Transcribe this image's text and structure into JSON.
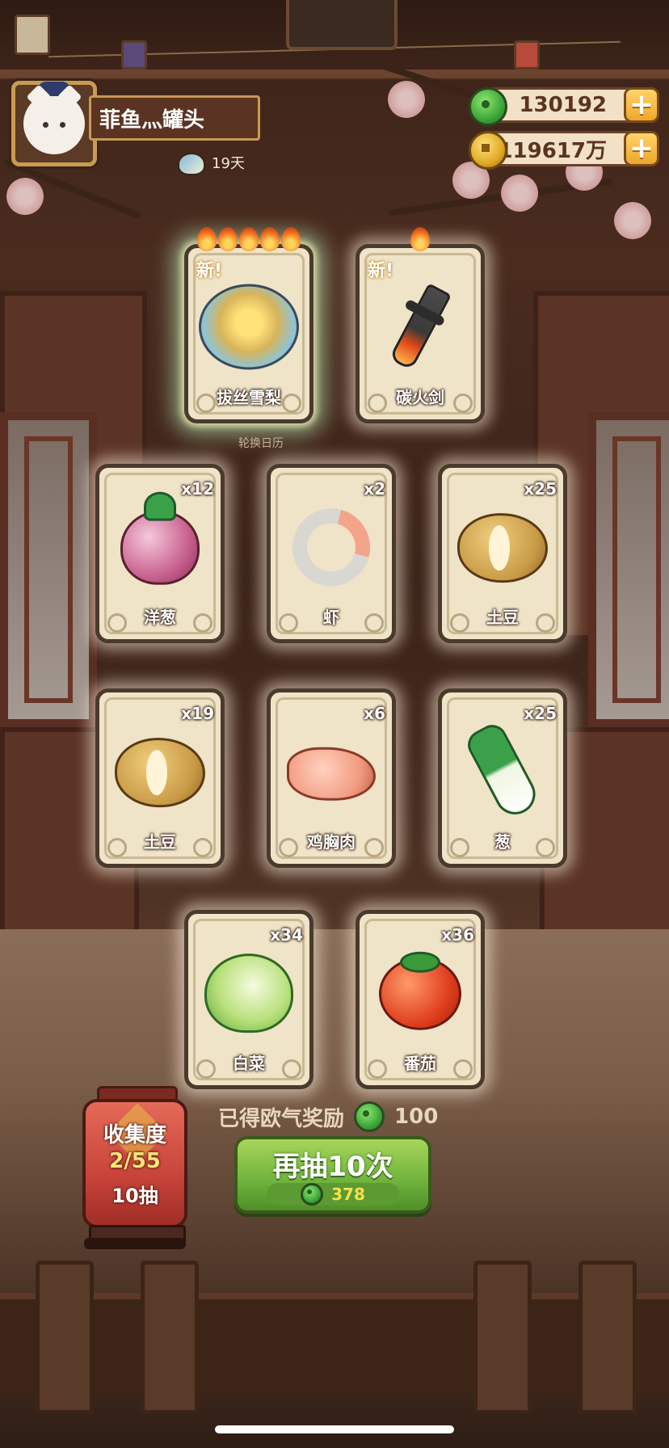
{
  "player": {
    "name": "菲鱼灬罐头",
    "days": "19天"
  },
  "currency": {
    "jade": "130192",
    "gold": "119617万"
  },
  "new_tag": "新!",
  "calendar_label": "轮换日历",
  "featured_cards": [
    {
      "name": "拔丝雪梨",
      "is_new": true,
      "stars": 5,
      "icon": "dessert-feast-icon"
    },
    {
      "name": "碳火剑",
      "is_new": true,
      "stars": 1,
      "icon": "charcoal-sword-icon"
    }
  ],
  "ingredient_cards": [
    {
      "name": "洋葱",
      "count": "x12",
      "icon": "onion-icon"
    },
    {
      "name": "虾",
      "count": "x2",
      "icon": "shrimp-icon"
    },
    {
      "name": "土豆",
      "count": "x25",
      "icon": "potato-icon"
    },
    {
      "name": "土豆",
      "count": "x19",
      "icon": "potato-icon"
    },
    {
      "name": "鸡胸肉",
      "count": "x6",
      "icon": "chicken-breast-icon"
    },
    {
      "name": "葱",
      "count": "x25",
      "icon": "scallion-icon"
    },
    {
      "name": "白菜",
      "count": "x34",
      "icon": "napa-cabbage-icon"
    },
    {
      "name": "番茄",
      "count": "x36",
      "icon": "tomato-icon"
    }
  ],
  "reward": {
    "label": "已得欧气奖励",
    "value": "100"
  },
  "redraw": {
    "label": "再抽10次",
    "cost": "378"
  },
  "collection": {
    "title": "收集度",
    "progress": "2/55",
    "draws": "10抽"
  },
  "colors": {
    "accent_green": "#6fb23c",
    "card_bg": "#efe3c8",
    "lantern_red": "#c8443a",
    "gold_border": "#c89b52"
  }
}
